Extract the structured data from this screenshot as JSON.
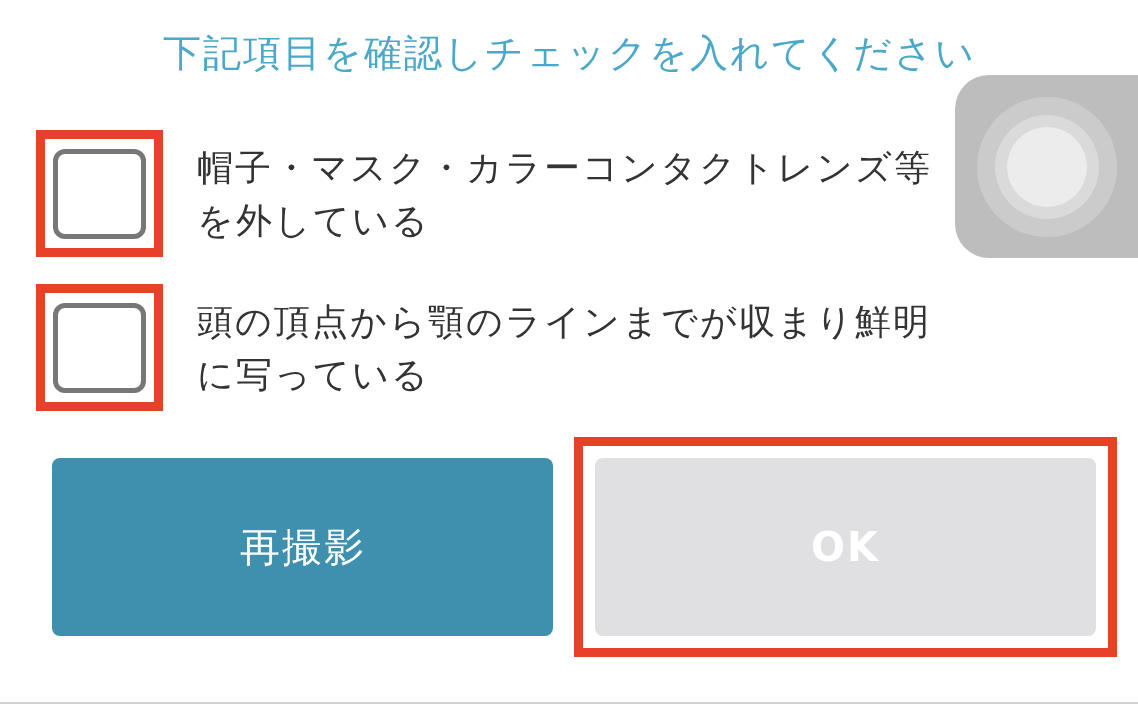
{
  "title": "下記項目を確認しチェックを入れてください",
  "checklist": [
    {
      "label": "帽子・マスク・カラーコンタクトレンズ等を外している",
      "checked": false,
      "highlighted": true
    },
    {
      "label": "頭の頂点から顎のラインまでが収まり鮮明に写っている",
      "checked": false,
      "highlighted": true
    }
  ],
  "buttons": [
    {
      "label": "再撮影",
      "kind": "primary",
      "disabled": false,
      "highlighted": false
    },
    {
      "label": "OK",
      "kind": "confirm",
      "disabled": true,
      "highlighted": true
    }
  ]
}
